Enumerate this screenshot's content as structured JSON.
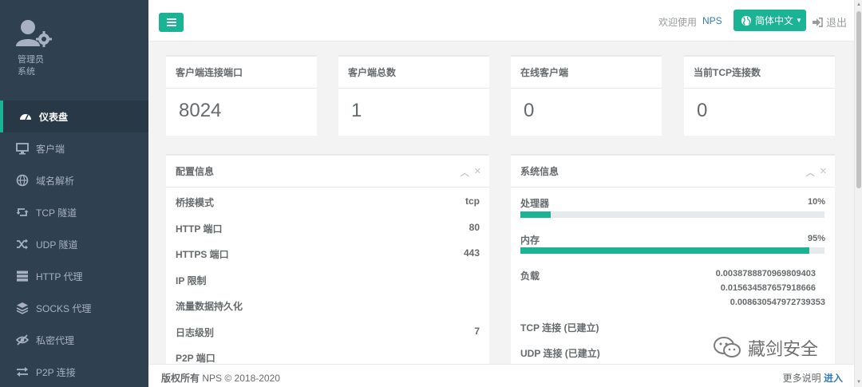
{
  "sidebar": {
    "role_line1": "管理员",
    "role_line2": "系统",
    "items": [
      {
        "label": "仪表盘",
        "icon": "dashboard-icon"
      },
      {
        "label": "客户端",
        "icon": "desktop-icon"
      },
      {
        "label": "域名解析",
        "icon": "globe-icon"
      },
      {
        "label": "TCP 隧道",
        "icon": "retweet-icon"
      },
      {
        "label": "UDP 隧道",
        "icon": "random-icon"
      },
      {
        "label": "HTTP 代理",
        "icon": "server-icon"
      },
      {
        "label": "SOCKS 代理",
        "icon": "layers-icon"
      },
      {
        "label": "私密代理",
        "icon": "eye-slash-icon"
      },
      {
        "label": "P2P 连接",
        "icon": "exchange-icon"
      }
    ]
  },
  "topbar": {
    "welcome": "欢迎使用",
    "brand": "NPS",
    "language": "简体中文",
    "logout": "退出"
  },
  "stats": [
    {
      "title": "客户端连接端口",
      "value": "8024"
    },
    {
      "title": "客户端总数",
      "value": "1"
    },
    {
      "title": "在线客户端",
      "value": "0"
    },
    {
      "title": "当前TCP连接数",
      "value": "0"
    }
  ],
  "config": {
    "title": "配置信息",
    "rows": [
      {
        "label": "桥接模式",
        "value": "tcp"
      },
      {
        "label": "HTTP 端口",
        "value": "80"
      },
      {
        "label": "HTTPS 端口",
        "value": "443"
      },
      {
        "label": "IP 限制",
        "value": ""
      },
      {
        "label": "流量数据持久化",
        "value": ""
      },
      {
        "label": "日志级别",
        "value": "7"
      },
      {
        "label": "P2P 端口",
        "value": ""
      }
    ]
  },
  "system": {
    "title": "系统信息",
    "cpu_label": "处理器",
    "cpu_pct": "10%",
    "cpu_fraction": 0.1,
    "mem_label": "内存",
    "mem_pct": "95%",
    "mem_fraction": 0.95,
    "load_label": "负载",
    "load_values": [
      "0.0038788870969809403",
      "0.015634587657918666",
      "0.008630547972739353"
    ],
    "tcp_label": "TCP 连接 (已建立)",
    "udp_label": "UDP 连接 (已建立)"
  },
  "footer": {
    "copyright_bold": "版权所有",
    "copyright_rest": "NPS © 2018-2020",
    "more_text": "更多说明",
    "more_link": "进入"
  },
  "watermark": "藏剑安全",
  "colors": {
    "sidebar": "#2f4050",
    "accent": "#1ab394",
    "link": "#337ab7"
  }
}
